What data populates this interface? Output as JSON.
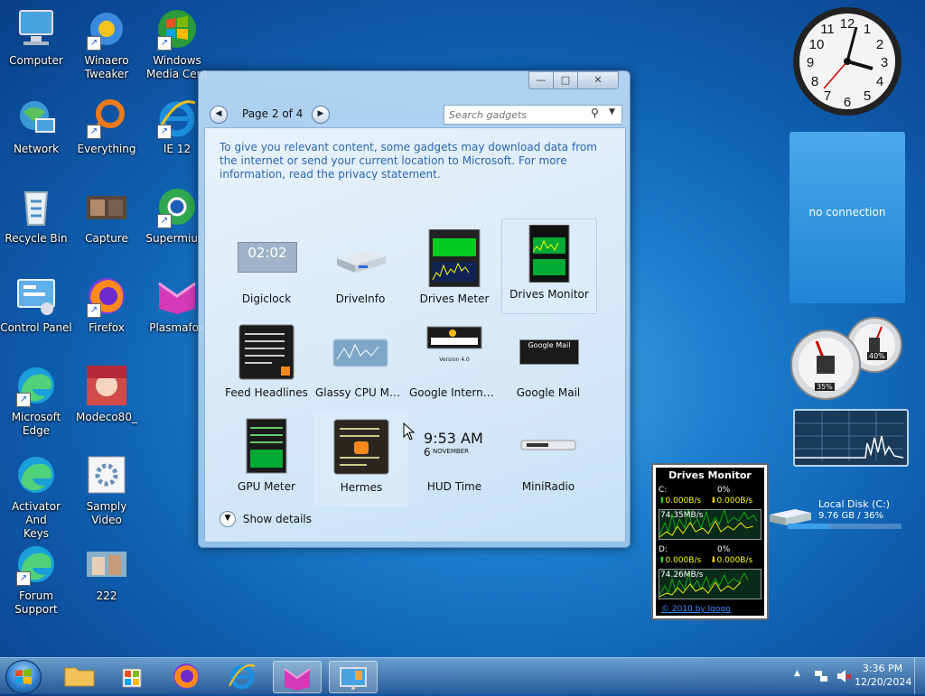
{
  "desktop": {
    "icons": [
      {
        "label": "Computer"
      },
      {
        "label": "Winaero\nTweaker"
      },
      {
        "label": "Windows\nMedia Cent"
      },
      {
        "label": "Network"
      },
      {
        "label": "Everything"
      },
      {
        "label": "IE 12"
      },
      {
        "label": "Recycle Bin"
      },
      {
        "label": "Capture"
      },
      {
        "label": "Supermium"
      },
      {
        "label": "Control Panel"
      },
      {
        "label": "Firefox"
      },
      {
        "label": "Plasmafox"
      },
      {
        "label": "Microsoft\nEdge"
      },
      {
        "label": "Modeco80_"
      },
      {
        "label": "Activator And\nKeys"
      },
      {
        "label": "Samply Video"
      },
      {
        "label": "Forum\nSupport"
      },
      {
        "label": "222"
      }
    ]
  },
  "gallery": {
    "page_label": "Page 2 of 4",
    "search_placeholder": "Search gadgets",
    "info_text": "To give you relevant content, some gadgets may download data from the internet or send your current location to Microsoft. For more information, read the privacy statement.",
    "gadgets": [
      {
        "label": "Digiclock"
      },
      {
        "label": "DriveInfo"
      },
      {
        "label": "Drives Meter"
      },
      {
        "label": "Drives Monitor"
      },
      {
        "label": "Feed Headlines"
      },
      {
        "label": "Glassy CPU Mo..."
      },
      {
        "label": "Google Internati..."
      },
      {
        "label": "Google Mail"
      },
      {
        "label": "GPU Meter"
      },
      {
        "label": "Hermes"
      },
      {
        "label": "HUD Time"
      },
      {
        "label": "MiniRadio"
      }
    ],
    "thumb_text": {
      "digiclock_time": "02:02",
      "hud_time": "9:53 AM",
      "hud_day": "6",
      "hud_month": "NOVEMBER",
      "google_mail": "Google Mail",
      "google_version": "Version 4.0"
    },
    "show_details": "Show details"
  },
  "weather": {
    "text": "no connection"
  },
  "cpu_meter": {
    "cpu_pct": "35%",
    "mem_pct": "40%"
  },
  "drive_info": {
    "name": "Local Disk (C:)",
    "detail": "9.76 GB / 36%",
    "fill_pct": 36
  },
  "drives_monitor": {
    "title": "Drives Monitor",
    "c_label": "C:",
    "c_pct": "0%",
    "c_up": "0.000B/s",
    "c_down": "0.000B/s",
    "c_scale": "74.35MB/s",
    "d_label": "D:",
    "d_pct": "0%",
    "d_up": "0.000B/s",
    "d_down": "0.000B/s",
    "d_scale": "74.26MB/s",
    "footer": "© 2010 by Igogo"
  },
  "taskbar": {
    "time": "3:36 PM",
    "date": "12/20/2024"
  },
  "colors": {
    "accent": "#1a6fd0",
    "link": "#1a5bd6"
  }
}
